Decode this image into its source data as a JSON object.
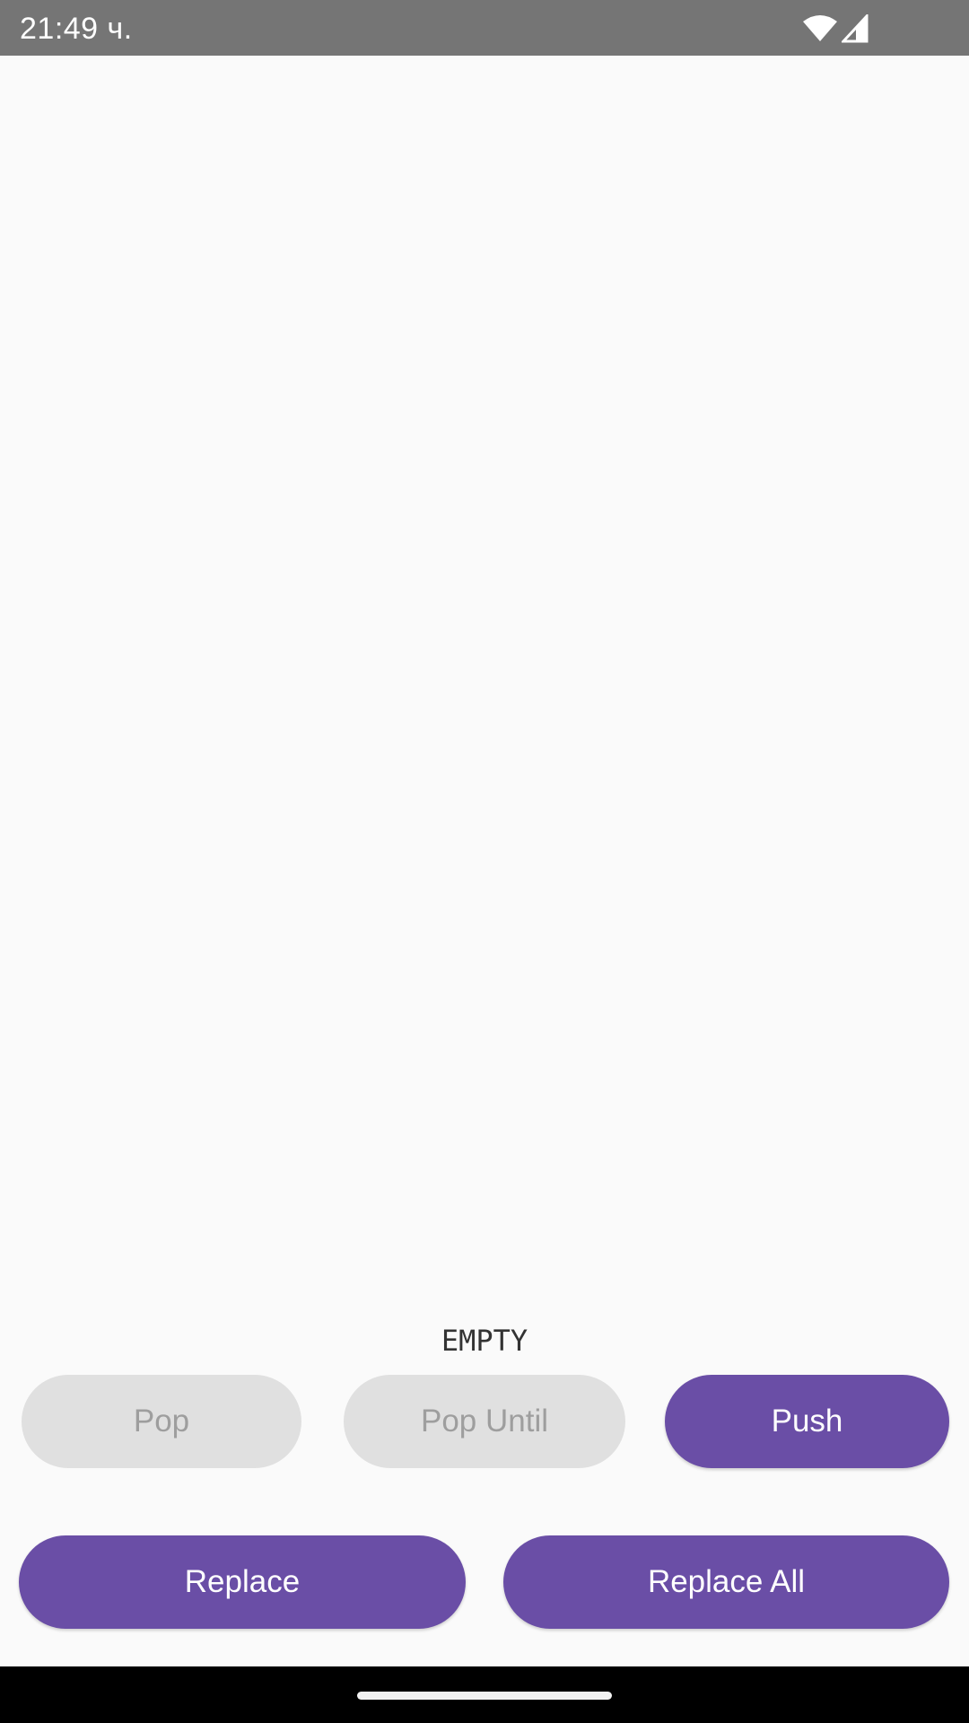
{
  "status_bar": {
    "time": "21:49 ч.",
    "icons": [
      "wifi-icon",
      "signal-icon"
    ]
  },
  "main": {
    "stack_label": "EMPTY"
  },
  "buttons": {
    "pop": "Pop",
    "pop_until": "Pop Until",
    "push": "Push",
    "replace": "Replace",
    "replace_all": "Replace All"
  },
  "colors": {
    "accent": "#6a4ea6",
    "disabled_bg": "#e0e0e0",
    "disabled_text": "#9e9e9e",
    "status_bar": "#757575",
    "background": "#fafafa"
  }
}
